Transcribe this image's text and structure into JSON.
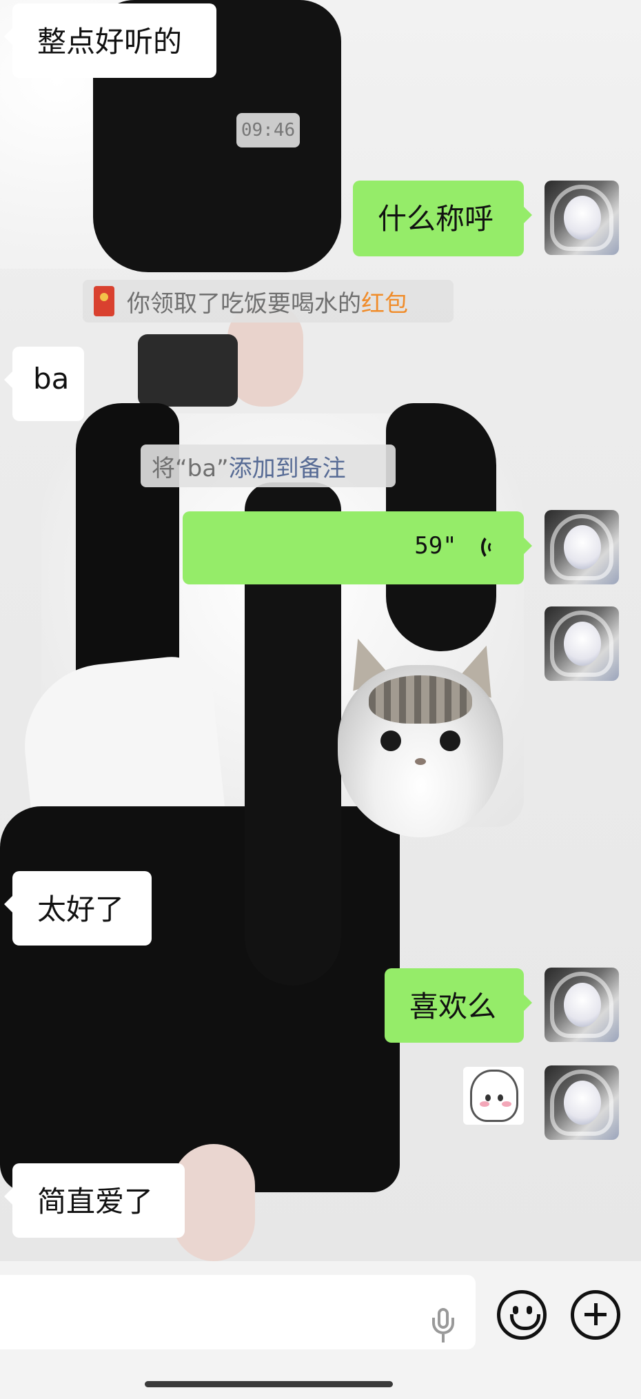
{
  "messages": {
    "m1": "整点好听的",
    "time": "09:46",
    "m2": "什么称呼",
    "redpacket_prefix": "你领取了吃饭要喝水的",
    "redpacket_word": "红包",
    "m3": "ba",
    "remark_prefix": "将“ba”",
    "remark_action": "添加到备注",
    "voice_duration": "59\"",
    "m4": "太好了",
    "m5": "喜欢么",
    "m6": "简直爱了"
  },
  "colors": {
    "outgoing_bubble": "#95ec69",
    "incoming_bubble": "#ffffff",
    "link_blue": "#576b95",
    "red_packet_orange": "#f08c2a"
  },
  "icons": [
    "red-packet-icon",
    "voice-waves-icon",
    "mic-icon",
    "emoji-icon",
    "plus-icon"
  ]
}
